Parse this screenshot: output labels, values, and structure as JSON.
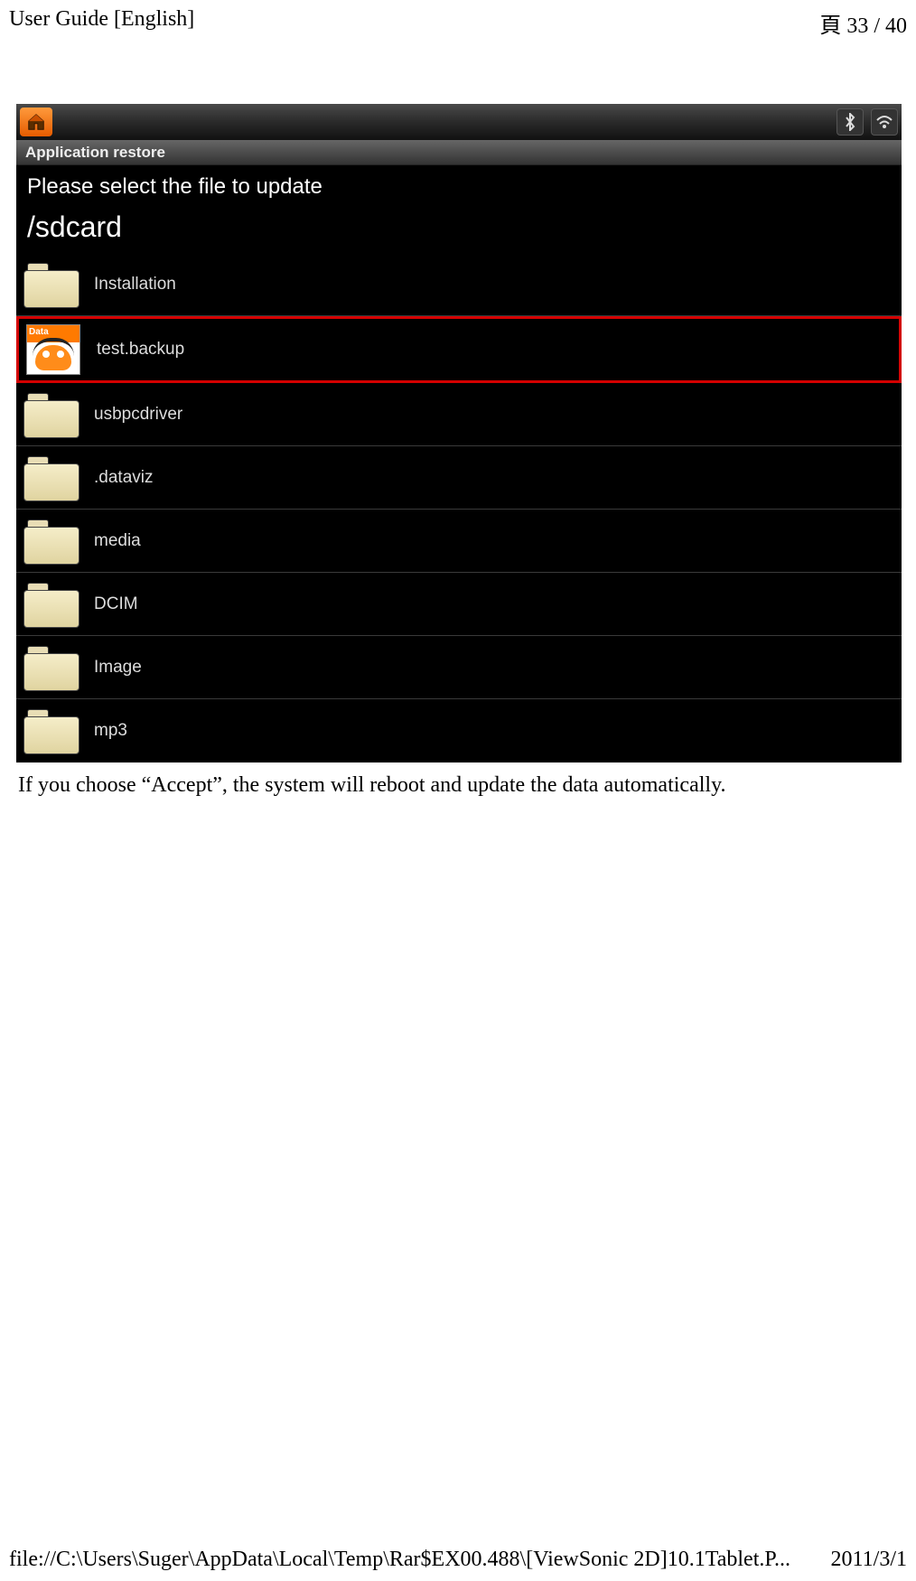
{
  "header": {
    "title": "User Guide [English]",
    "page_indicator": "頁 33 / 40"
  },
  "screenshot": {
    "title_bar": "Application restore",
    "prompt": "Please select the file to update",
    "path": "/sdcard",
    "items": [
      {
        "label": "Installation",
        "type": "folder",
        "selected": false
      },
      {
        "label": "test.backup",
        "type": "backup",
        "selected": true,
        "tag": "Data"
      },
      {
        "label": "usbpcdriver",
        "type": "folder",
        "selected": false
      },
      {
        "label": ".dataviz",
        "type": "folder",
        "selected": false
      },
      {
        "label": "media",
        "type": "folder",
        "selected": false
      },
      {
        "label": "DCIM",
        "type": "folder",
        "selected": false
      },
      {
        "label": "Image",
        "type": "folder",
        "selected": false
      },
      {
        "label": "mp3",
        "type": "folder",
        "selected": false
      }
    ]
  },
  "body_text": "If you choose “Accept”, the system will reboot and update the data automatically.",
  "footer": {
    "path": "file://C:\\Users\\Suger\\AppData\\Local\\Temp\\Rar$EX00.488\\[ViewSonic 2D]10.1Tablet.P...",
    "date": "2011/3/1"
  }
}
